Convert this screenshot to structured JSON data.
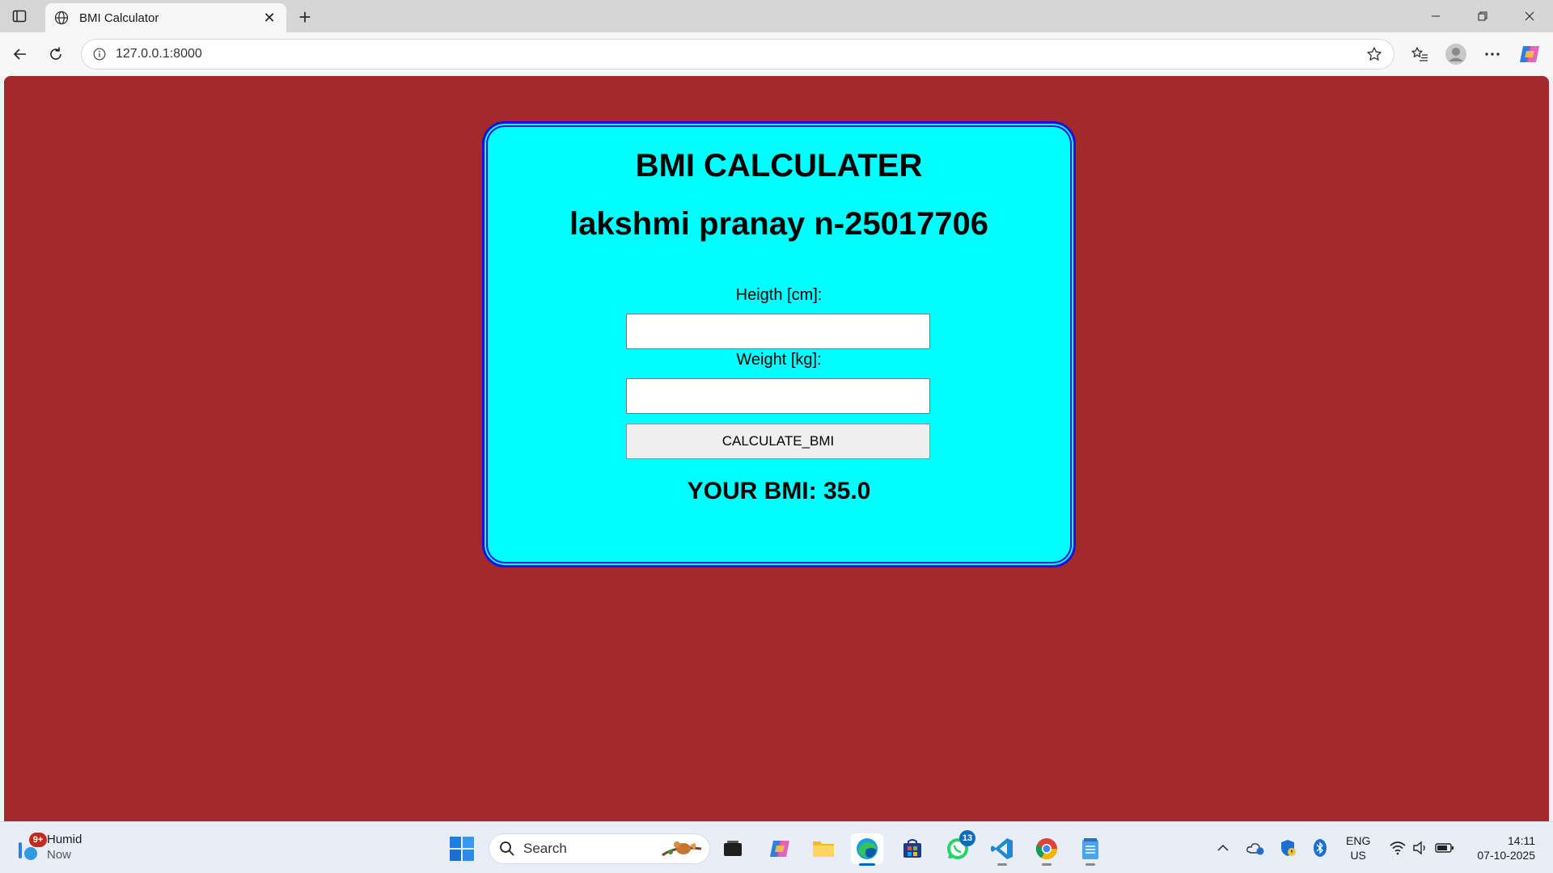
{
  "browser": {
    "tab_title": "BMI Calculator",
    "address": "127.0.0.1:8000"
  },
  "page": {
    "title": "BMI CALCULATER",
    "subtitle": "lakshmi pranay n-25017706",
    "height_label": "Heigth [cm]:",
    "height_value": "",
    "weight_label": "Weight [kg]:",
    "weight_value": "",
    "button_label": "CALCULATE_BMI",
    "result": "YOUR BMI: 35.0"
  },
  "colors": {
    "page_background": "#a3292a",
    "card_background": "#00ffff",
    "card_border": "#1a0fe0"
  },
  "taskbar": {
    "weather_title": "Humid",
    "weather_sub": "Now",
    "weather_badge": "9+",
    "search_placeholder": "Search",
    "whatsapp_badge": "13",
    "language_line1": "ENG",
    "language_line2": "US",
    "time": "14:11",
    "date": "07-10-2025",
    "apps": [
      "task-view-icon",
      "copilot-icon",
      "file-explorer-icon",
      "edge-icon",
      "store-icon",
      "whatsapp-icon",
      "vscode-icon",
      "chrome-icon",
      "notepad-icon"
    ]
  }
}
